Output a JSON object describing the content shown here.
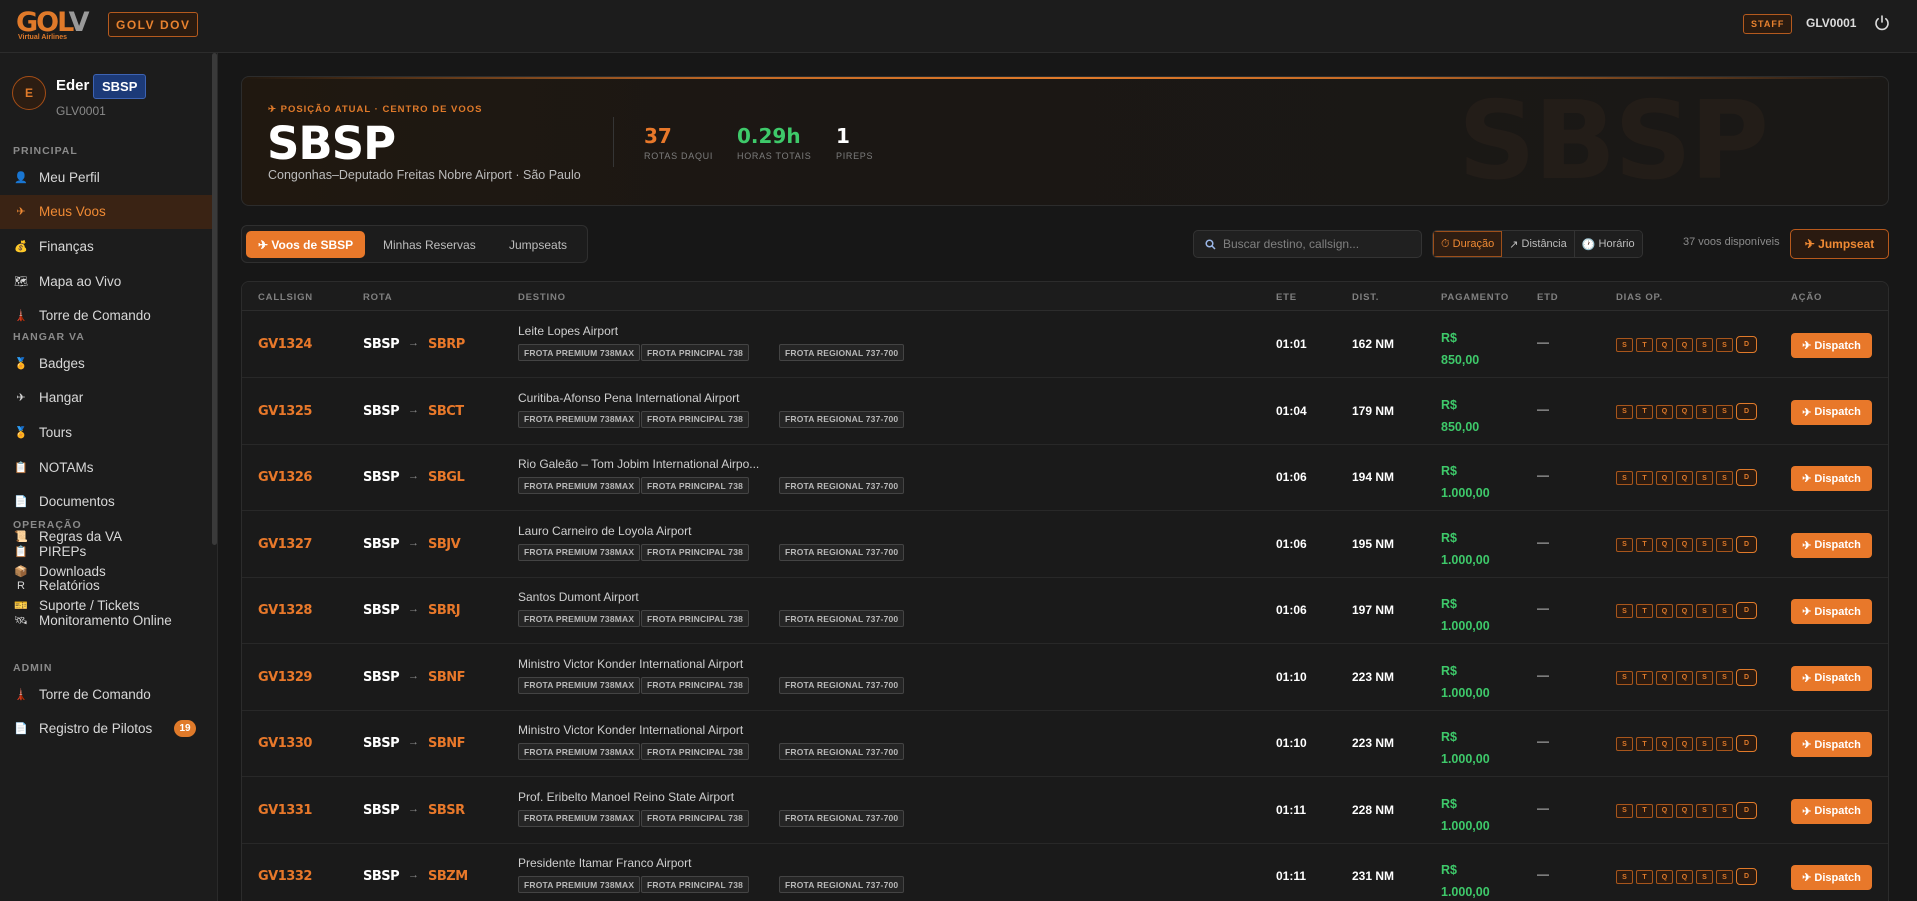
{
  "header": {
    "logo_text": "GOLV",
    "logo_subtitle": "Virtual Airlines",
    "dev_badge": "GOLV DOV",
    "staff_badge": "STAFF",
    "user_id": "GLV0001"
  },
  "sidebar": {
    "profile": {
      "initial": "E",
      "name": "Eder",
      "icao": "SBSP",
      "callsign": "GLV0001"
    },
    "sections": [
      {
        "title": "PRINCIPAL",
        "items": [
          {
            "label": "Meu Perfil",
            "icon": "user-icon",
            "active": false
          },
          {
            "label": "Meus Voos",
            "icon": "plane-icon",
            "active": true
          },
          {
            "label": "Finanças",
            "icon": "money-bag-icon",
            "active": false
          },
          {
            "label": "Mapa ao Vivo",
            "icon": "map-icon",
            "active": false
          },
          {
            "label": "Torre de Comando",
            "icon": "tower-icon",
            "active": false
          }
        ]
      },
      {
        "title": "HANGAR VA",
        "items": [
          {
            "label": "Badges",
            "icon": "medal-icon",
            "active": false
          },
          {
            "label": "Hangar",
            "icon": "hangar-icon",
            "active": false
          },
          {
            "label": "Tours",
            "icon": "medal-icon",
            "active": false
          },
          {
            "label": "NOTAMs",
            "icon": "clipboard-icon",
            "active": false
          },
          {
            "label": "Documentos",
            "icon": "document-icon",
            "active": false
          },
          {
            "label": "Regras da VA",
            "icon": "scroll-icon",
            "active": false
          },
          {
            "label": "Downloads",
            "icon": "box-icon",
            "active": false
          },
          {
            "label": "Suporte / Tickets",
            "icon": "ticket-icon",
            "active": false
          }
        ]
      },
      {
        "title": "OPERAÇÃO",
        "items": [
          {
            "label": "PIREPs",
            "icon": "clipboard-icon",
            "active": false
          },
          {
            "label": "Relatórios",
            "icon": "r-letter-icon",
            "active": false
          },
          {
            "label": "Monitoramento Online",
            "icon": "satellite-icon",
            "active": false
          }
        ]
      },
      {
        "title": "ADMIN",
        "items": [
          {
            "label": "Torre de Comando",
            "icon": "tower-icon",
            "active": false
          },
          {
            "label": "Registro de Pilotos",
            "icon": "document-icon",
            "active": false,
            "count": "19"
          }
        ]
      }
    ]
  },
  "hero": {
    "label": "POSIÇÃO ATUAL · CENTRO DE VOOS",
    "icao": "SBSP",
    "name": "Congonhas–Deputado Freitas Nobre Airport · São Paulo",
    "watermark": "SBSP",
    "stats": [
      {
        "value": "37",
        "label": "ROTAS DAQUI",
        "color": "#e8782a"
      },
      {
        "value": "0.29h",
        "label": "HORAS TOTAIS",
        "color": "#3ec96a"
      },
      {
        "value": "1",
        "label": "PIREPS",
        "color": "#ffffff"
      }
    ]
  },
  "tabs": [
    "Voos de SBSP",
    "Minhas Reservas",
    "Jumpseats"
  ],
  "search": {
    "placeholder": "Buscar destino, callsign..."
  },
  "sort": [
    "Duração",
    "Distância",
    "Horário"
  ],
  "available": "37 voos disponíveis",
  "jumpseat_label": "Jumpseat",
  "table": {
    "headers": [
      "CALLSIGN",
      "ROTA",
      "DESTINO",
      "ETE",
      "DIST.",
      "PAGAMENTO",
      "ETD",
      "DIAS OP.",
      "AÇÃO"
    ],
    "fleets": [
      "FROTA PREMIUM 738MAX",
      "FROTA PRINCIPAL 738",
      "FROTA REGIONAL 737-700"
    ],
    "days": [
      "S",
      "T",
      "Q",
      "Q",
      "S",
      "S",
      "D"
    ],
    "action_label": "Dispatch",
    "rows": [
      {
        "callsign": "GV1324",
        "orig": "SBSP",
        "dest": "SBRP",
        "dest_name": "Leite Lopes Airport",
        "ete": "01:01",
        "dist": "162 NM",
        "pay_cur": "R$",
        "pay_val": "850,00",
        "etd": "—"
      },
      {
        "callsign": "GV1325",
        "orig": "SBSP",
        "dest": "SBCT",
        "dest_name": "Curitiba-Afonso Pena International Airport",
        "ete": "01:04",
        "dist": "179 NM",
        "pay_cur": "R$",
        "pay_val": "850,00",
        "etd": "—"
      },
      {
        "callsign": "GV1326",
        "orig": "SBSP",
        "dest": "SBGL",
        "dest_name": "Rio Galeão – Tom Jobim International Airpo...",
        "ete": "01:06",
        "dist": "194 NM",
        "pay_cur": "R$",
        "pay_val": "1.000,00",
        "etd": "—"
      },
      {
        "callsign": "GV1327",
        "orig": "SBSP",
        "dest": "SBJV",
        "dest_name": "Lauro Carneiro de Loyola Airport",
        "ete": "01:06",
        "dist": "195 NM",
        "pay_cur": "R$",
        "pay_val": "1.000,00",
        "etd": "—"
      },
      {
        "callsign": "GV1328",
        "orig": "SBSP",
        "dest": "SBRJ",
        "dest_name": "Santos Dumont Airport",
        "ete": "01:06",
        "dist": "197 NM",
        "pay_cur": "R$",
        "pay_val": "1.000,00",
        "etd": "—"
      },
      {
        "callsign": "GV1329",
        "orig": "SBSP",
        "dest": "SBNF",
        "dest_name": "Ministro Victor Konder International Airport",
        "ete": "01:10",
        "dist": "223 NM",
        "pay_cur": "R$",
        "pay_val": "1.000,00",
        "etd": "—"
      },
      {
        "callsign": "GV1330",
        "orig": "SBSP",
        "dest": "SBNF",
        "dest_name": "Ministro Victor Konder International Airport",
        "ete": "01:10",
        "dist": "223 NM",
        "pay_cur": "R$",
        "pay_val": "1.000,00",
        "etd": "—"
      },
      {
        "callsign": "GV1331",
        "orig": "SBSP",
        "dest": "SBSR",
        "dest_name": "Prof. Eribelto Manoel Reino State Airport",
        "ete": "01:11",
        "dist": "228 NM",
        "pay_cur": "R$",
        "pay_val": "1.000,00",
        "etd": "—"
      },
      {
        "callsign": "GV1332",
        "orig": "SBSP",
        "dest": "SBZM",
        "dest_name": "Presidente Itamar Franco Airport",
        "ete": "01:11",
        "dist": "231 NM",
        "pay_cur": "R$",
        "pay_val": "1.000,00",
        "etd": "—"
      }
    ]
  }
}
